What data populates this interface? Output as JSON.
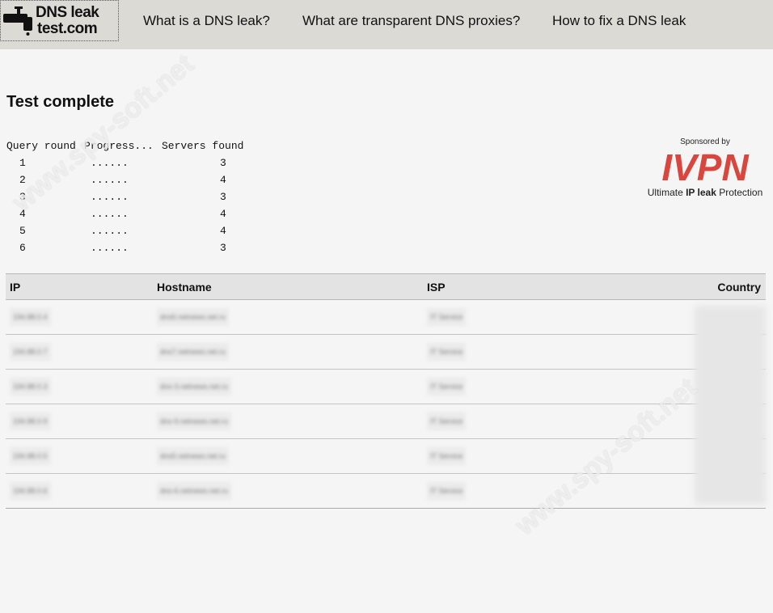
{
  "header": {
    "logo_line1": "DNS leak",
    "logo_line2": "test.com",
    "nav": [
      "What is a DNS leak?",
      "What are transparent DNS proxies?",
      "How to fix a DNS leak"
    ]
  },
  "main": {
    "title": "Test complete",
    "progress": {
      "headers": [
        "Query round",
        "Progress...",
        "Servers found"
      ],
      "rows": [
        {
          "round": "1",
          "progress": "......",
          "servers": "3"
        },
        {
          "round": "2",
          "progress": "......",
          "servers": "4"
        },
        {
          "round": "3",
          "progress": "......",
          "servers": "3"
        },
        {
          "round": "4",
          "progress": "......",
          "servers": "4"
        },
        {
          "round": "5",
          "progress": "......",
          "servers": "4"
        },
        {
          "round": "6",
          "progress": "......",
          "servers": "3"
        }
      ]
    }
  },
  "sponsor": {
    "by": "Sponsored by",
    "brand": "IVPN",
    "brand_color": "#d9463d",
    "tag_pre": "Ultimate ",
    "tag_bold": "IP leak",
    "tag_post": " Protection"
  },
  "results": {
    "columns": [
      "IP",
      "Hostname",
      "ISP",
      "Country"
    ],
    "rows": [
      {
        "ip": "194.88.0.4",
        "host": "dns6.netnews.net.ru",
        "isp": "IT Service"
      },
      {
        "ip": "194.88.0.7",
        "host": "dns7.netnews.net.ru",
        "isp": "IT Service"
      },
      {
        "ip": "194.88.0.3",
        "host": "dns-3.netnews.net.ru",
        "isp": "IT Service"
      },
      {
        "ip": "194.88.0.9",
        "host": "dns-9.netnews.net.ru",
        "isp": "IT Service"
      },
      {
        "ip": "194.88.0.5",
        "host": "dns5.netnews.net.ru",
        "isp": "IT Service"
      },
      {
        "ip": "194.88.0.6",
        "host": "dns-6.netnews.net.ru",
        "isp": "IT Service"
      }
    ]
  },
  "watermark": "www.spy-soft.net"
}
